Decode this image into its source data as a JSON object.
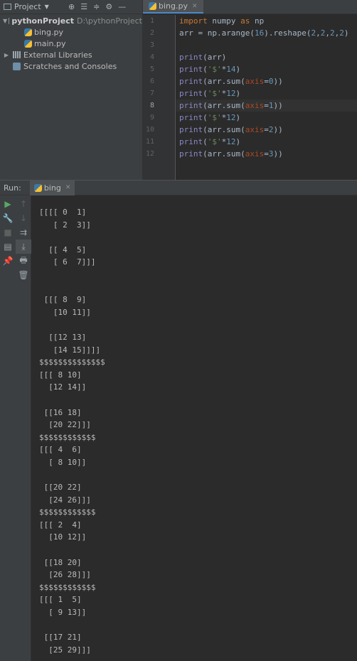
{
  "project": {
    "title": "Project",
    "tree": [
      {
        "label": "pythonProject",
        "path": "D:\\pythonProject"
      },
      {
        "label": "bing.py"
      },
      {
        "label": "main.py"
      },
      {
        "label": "External Libraries"
      },
      {
        "label": "Scratches and Consoles"
      }
    ]
  },
  "editor": {
    "tab_label": "bing.py",
    "current_line": 8,
    "line_numbers": [
      "1",
      "2",
      "3",
      "4",
      "5",
      "6",
      "7",
      "8",
      "9",
      "10",
      "11",
      "12"
    ],
    "lines": [
      "import numpy as np",
      "arr = np.arange(16).reshape(2,2,2,2)",
      "",
      "print(arr)",
      "print('$'*14)",
      "print(arr.sum(axis=0))",
      "print('$'*12)",
      "print(arr.sum(axis=1))",
      "print('$'*12)",
      "print(arr.sum(axis=2))",
      "print('$'*12)",
      "print(arr.sum(axis=3))"
    ]
  },
  "run": {
    "label": "Run:",
    "tab_label": "bing",
    "output": "[[[[ 0  1]\n   [ 2  3]]\n\n  [[ 4  5]\n   [ 6  7]]]\n\n\n [[[ 8  9]\n   [10 11]]\n\n  [[12 13]\n   [14 15]]]]\n$$$$$$$$$$$$$$\n[[[ 8 10]\n  [12 14]]\n\n [[16 18]\n  [20 22]]]\n$$$$$$$$$$$$\n[[[ 4  6]\n  [ 8 10]]\n\n [[20 22]\n  [24 26]]]\n$$$$$$$$$$$$\n[[[ 2  4]\n  [10 12]]\n\n [[18 20]\n  [26 28]]]\n$$$$$$$$$$$$\n[[[ 1  5]\n  [ 9 13]]\n\n [[17 21]\n  [25 29]]]"
  },
  "colors": {
    "keyword": "#cc7832",
    "builtin": "#8888c6",
    "number": "#6897bb",
    "string": "#6a8759",
    "param": "#aa4926",
    "run_green": "#59a869"
  }
}
